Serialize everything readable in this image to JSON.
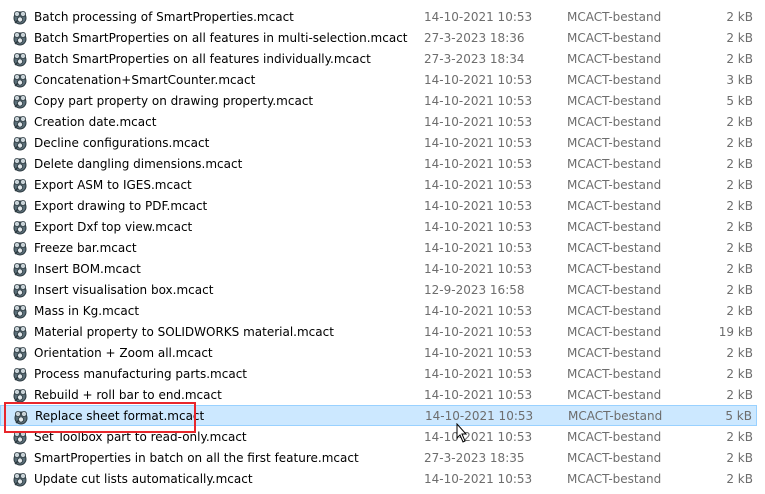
{
  "files": [
    {
      "name": "Batch processing of SmartProperties.mcact",
      "date": "14-10-2021 10:53",
      "type": "MCACT-bestand",
      "size": "2 kB"
    },
    {
      "name": "Batch SmartProperties on all features in multi-selection.mcact",
      "date": "27-3-2023 18:36",
      "type": "MCACT-bestand",
      "size": "2 kB"
    },
    {
      "name": "Batch SmartProperties on all features individually.mcact",
      "date": "27-3-2023 18:34",
      "type": "MCACT-bestand",
      "size": "2 kB"
    },
    {
      "name": "Concatenation+SmartCounter.mcact",
      "date": "14-10-2021 10:53",
      "type": "MCACT-bestand",
      "size": "3 kB"
    },
    {
      "name": "Copy part property on drawing property.mcact",
      "date": "14-10-2021 10:53",
      "type": "MCACT-bestand",
      "size": "5 kB"
    },
    {
      "name": "Creation date.mcact",
      "date": "14-10-2021 10:53",
      "type": "MCACT-bestand",
      "size": "2 kB"
    },
    {
      "name": "Decline configurations.mcact",
      "date": "14-10-2021 10:53",
      "type": "MCACT-bestand",
      "size": "2 kB"
    },
    {
      "name": "Delete dangling dimensions.mcact",
      "date": "14-10-2021 10:53",
      "type": "MCACT-bestand",
      "size": "2 kB"
    },
    {
      "name": "Export ASM to IGES.mcact",
      "date": "14-10-2021 10:53",
      "type": "MCACT-bestand",
      "size": "2 kB"
    },
    {
      "name": "Export drawing to PDF.mcact",
      "date": "14-10-2021 10:53",
      "type": "MCACT-bestand",
      "size": "2 kB"
    },
    {
      "name": "Export Dxf top view.mcact",
      "date": "14-10-2021 10:53",
      "type": "MCACT-bestand",
      "size": "2 kB"
    },
    {
      "name": "Freeze bar.mcact",
      "date": "14-10-2021 10:53",
      "type": "MCACT-bestand",
      "size": "2 kB"
    },
    {
      "name": "Insert BOM.mcact",
      "date": "14-10-2021 10:53",
      "type": "MCACT-bestand",
      "size": "2 kB"
    },
    {
      "name": "Insert visualisation box.mcact",
      "date": "12-9-2023 16:58",
      "type": "MCACT-bestand",
      "size": "2 kB"
    },
    {
      "name": "Mass in Kg.mcact",
      "date": "14-10-2021 10:53",
      "type": "MCACT-bestand",
      "size": "2 kB"
    },
    {
      "name": "Material property to SOLIDWORKS material.mcact",
      "date": "14-10-2021 10:53",
      "type": "MCACT-bestand",
      "size": "19 kB"
    },
    {
      "name": "Orientation + Zoom all.mcact",
      "date": "14-10-2021 10:53",
      "type": "MCACT-bestand",
      "size": "2 kB"
    },
    {
      "name": "Process manufacturing parts.mcact",
      "date": "14-10-2021 10:53",
      "type": "MCACT-bestand",
      "size": "2 kB"
    },
    {
      "name": "Rebuild + roll bar to end.mcact",
      "date": "14-10-2021 10:53",
      "type": "MCACT-bestand",
      "size": "2 kB"
    },
    {
      "name": "Replace sheet format.mcact",
      "date": "14-10-2021 10:53",
      "type": "MCACT-bestand",
      "size": "5 kB",
      "selected": true
    },
    {
      "name": "Set Toolbox part to read-only.mcact",
      "date": "14-10-2021 10:53",
      "type": "MCACT-bestand",
      "size": "2 kB"
    },
    {
      "name": "SmartProperties in batch on all the first feature.mcact",
      "date": "27-3-2023 18:35",
      "type": "MCACT-bestand",
      "size": "2 kB"
    },
    {
      "name": "Update cut lists automatically.mcact",
      "date": "14-10-2021 10:53",
      "type": "MCACT-bestand",
      "size": "2 kB"
    }
  ],
  "icon": "mcact-file-icon",
  "colors": {
    "selection_bg": "#cce8ff",
    "selection_border": "#99d1ff",
    "highlight_box": "#e8262b",
    "secondary_text": "#6d6d6d"
  }
}
